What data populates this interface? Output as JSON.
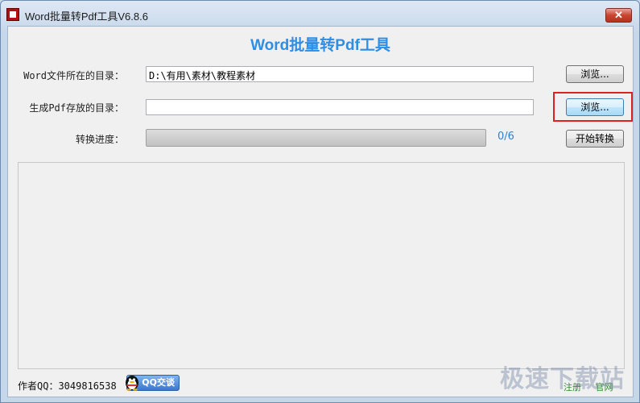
{
  "window": {
    "title": "Word批量转Pdf工具V6.8.6",
    "close_label": "✕"
  },
  "header": {
    "title": "Word批量转Pdf工具"
  },
  "form": {
    "source_dir": {
      "label": "Word文件所在的目录：",
      "value": "D:\\有用\\素材\\教程素材",
      "browse_label": "浏览..."
    },
    "output_dir": {
      "label": "生成Pdf存放的目录：",
      "value": "",
      "browse_label": "浏览..."
    },
    "progress": {
      "label": "转换进度：",
      "fraction": 0,
      "count_text": "0/6",
      "start_label": "开始转换"
    }
  },
  "footer": {
    "author": "作者QQ：3049816538",
    "qq_button": "QQ交谈",
    "register": "注册",
    "website": "官网"
  },
  "watermark": "极速下载站",
  "colors": {
    "heading": "#2f8de4",
    "highlight": "#e02020"
  }
}
